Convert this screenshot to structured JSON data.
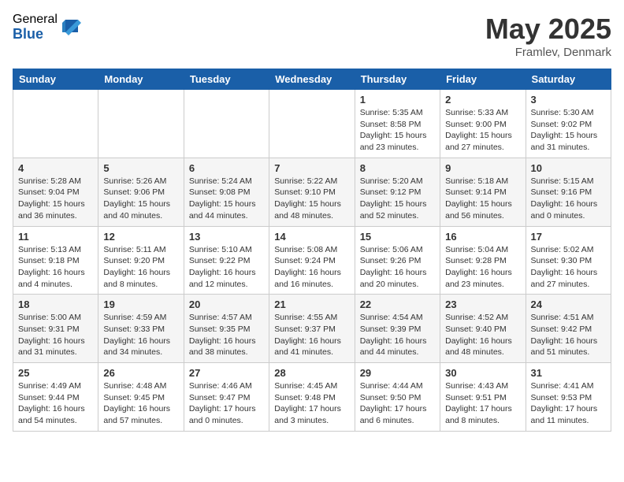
{
  "logo": {
    "general": "General",
    "blue": "Blue"
  },
  "title": "May 2025",
  "location": "Framlev, Denmark",
  "days_of_week": [
    "Sunday",
    "Monday",
    "Tuesday",
    "Wednesday",
    "Thursday",
    "Friday",
    "Saturday"
  ],
  "weeks": [
    [
      {
        "day": "",
        "info": ""
      },
      {
        "day": "",
        "info": ""
      },
      {
        "day": "",
        "info": ""
      },
      {
        "day": "",
        "info": ""
      },
      {
        "day": "1",
        "info": "Sunrise: 5:35 AM\nSunset: 8:58 PM\nDaylight: 15 hours\nand 23 minutes."
      },
      {
        "day": "2",
        "info": "Sunrise: 5:33 AM\nSunset: 9:00 PM\nDaylight: 15 hours\nand 27 minutes."
      },
      {
        "day": "3",
        "info": "Sunrise: 5:30 AM\nSunset: 9:02 PM\nDaylight: 15 hours\nand 31 minutes."
      }
    ],
    [
      {
        "day": "4",
        "info": "Sunrise: 5:28 AM\nSunset: 9:04 PM\nDaylight: 15 hours\nand 36 minutes."
      },
      {
        "day": "5",
        "info": "Sunrise: 5:26 AM\nSunset: 9:06 PM\nDaylight: 15 hours\nand 40 minutes."
      },
      {
        "day": "6",
        "info": "Sunrise: 5:24 AM\nSunset: 9:08 PM\nDaylight: 15 hours\nand 44 minutes."
      },
      {
        "day": "7",
        "info": "Sunrise: 5:22 AM\nSunset: 9:10 PM\nDaylight: 15 hours\nand 48 minutes."
      },
      {
        "day": "8",
        "info": "Sunrise: 5:20 AM\nSunset: 9:12 PM\nDaylight: 15 hours\nand 52 minutes."
      },
      {
        "day": "9",
        "info": "Sunrise: 5:18 AM\nSunset: 9:14 PM\nDaylight: 15 hours\nand 56 minutes."
      },
      {
        "day": "10",
        "info": "Sunrise: 5:15 AM\nSunset: 9:16 PM\nDaylight: 16 hours\nand 0 minutes."
      }
    ],
    [
      {
        "day": "11",
        "info": "Sunrise: 5:13 AM\nSunset: 9:18 PM\nDaylight: 16 hours\nand 4 minutes."
      },
      {
        "day": "12",
        "info": "Sunrise: 5:11 AM\nSunset: 9:20 PM\nDaylight: 16 hours\nand 8 minutes."
      },
      {
        "day": "13",
        "info": "Sunrise: 5:10 AM\nSunset: 9:22 PM\nDaylight: 16 hours\nand 12 minutes."
      },
      {
        "day": "14",
        "info": "Sunrise: 5:08 AM\nSunset: 9:24 PM\nDaylight: 16 hours\nand 16 minutes."
      },
      {
        "day": "15",
        "info": "Sunrise: 5:06 AM\nSunset: 9:26 PM\nDaylight: 16 hours\nand 20 minutes."
      },
      {
        "day": "16",
        "info": "Sunrise: 5:04 AM\nSunset: 9:28 PM\nDaylight: 16 hours\nand 23 minutes."
      },
      {
        "day": "17",
        "info": "Sunrise: 5:02 AM\nSunset: 9:30 PM\nDaylight: 16 hours\nand 27 minutes."
      }
    ],
    [
      {
        "day": "18",
        "info": "Sunrise: 5:00 AM\nSunset: 9:31 PM\nDaylight: 16 hours\nand 31 minutes."
      },
      {
        "day": "19",
        "info": "Sunrise: 4:59 AM\nSunset: 9:33 PM\nDaylight: 16 hours\nand 34 minutes."
      },
      {
        "day": "20",
        "info": "Sunrise: 4:57 AM\nSunset: 9:35 PM\nDaylight: 16 hours\nand 38 minutes."
      },
      {
        "day": "21",
        "info": "Sunrise: 4:55 AM\nSunset: 9:37 PM\nDaylight: 16 hours\nand 41 minutes."
      },
      {
        "day": "22",
        "info": "Sunrise: 4:54 AM\nSunset: 9:39 PM\nDaylight: 16 hours\nand 44 minutes."
      },
      {
        "day": "23",
        "info": "Sunrise: 4:52 AM\nSunset: 9:40 PM\nDaylight: 16 hours\nand 48 minutes."
      },
      {
        "day": "24",
        "info": "Sunrise: 4:51 AM\nSunset: 9:42 PM\nDaylight: 16 hours\nand 51 minutes."
      }
    ],
    [
      {
        "day": "25",
        "info": "Sunrise: 4:49 AM\nSunset: 9:44 PM\nDaylight: 16 hours\nand 54 minutes."
      },
      {
        "day": "26",
        "info": "Sunrise: 4:48 AM\nSunset: 9:45 PM\nDaylight: 16 hours\nand 57 minutes."
      },
      {
        "day": "27",
        "info": "Sunrise: 4:46 AM\nSunset: 9:47 PM\nDaylight: 17 hours\nand 0 minutes."
      },
      {
        "day": "28",
        "info": "Sunrise: 4:45 AM\nSunset: 9:48 PM\nDaylight: 17 hours\nand 3 minutes."
      },
      {
        "day": "29",
        "info": "Sunrise: 4:44 AM\nSunset: 9:50 PM\nDaylight: 17 hours\nand 6 minutes."
      },
      {
        "day": "30",
        "info": "Sunrise: 4:43 AM\nSunset: 9:51 PM\nDaylight: 17 hours\nand 8 minutes."
      },
      {
        "day": "31",
        "info": "Sunrise: 4:41 AM\nSunset: 9:53 PM\nDaylight: 17 hours\nand 11 minutes."
      }
    ]
  ]
}
